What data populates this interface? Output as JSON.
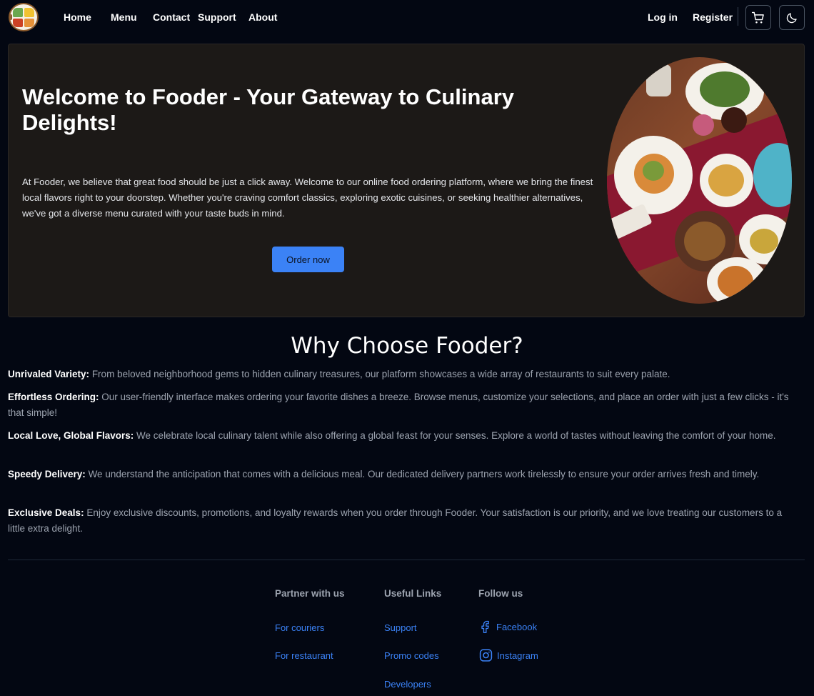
{
  "nav": {
    "links": [
      "Home",
      "Menu",
      "Contact",
      "Support",
      "About"
    ],
    "login": "Log in",
    "register": "Register"
  },
  "hero": {
    "title": "Welcome to Fooder - Your Gateway to Culinary Delights!",
    "text": "At Fooder, we believe that great food should be just a click away. Welcome to our online food ordering platform, where we bring the finest local flavors right to your doorstep. Whether you're craving comfort classics, exploring exotic cuisines, or seeking healthier alternatives, we've got a diverse menu curated with your taste buds in mind.",
    "button": "Order now"
  },
  "why": {
    "title": "Why Choose Fooder?",
    "items": [
      {
        "label": "Unrivaled Variety:",
        "text": " From beloved neighborhood gems to hidden culinary treasures, our platform showcases a wide array of restaurants to suit every palate."
      },
      {
        "label": "Effortless Ordering:",
        "text": " Our user-friendly interface makes ordering your favorite dishes a breeze. Browse menus, customize your selections, and place an order with just a few clicks - it's that simple!"
      },
      {
        "label": "Local Love, Global Flavors:",
        "text": " We celebrate local culinary talent while also offering a global feast for your senses. Explore a world of tastes without leaving the comfort of your home."
      },
      {
        "label": "Speedy Delivery:",
        "text": " We understand the anticipation that comes with a delicious meal. Our dedicated delivery partners work tirelessly to ensure your order arrives fresh and timely."
      },
      {
        "label": "Exclusive Deals:",
        "text": " Enjoy exclusive discounts, promotions, and loyalty rewards when you order through Fooder. Your satisfaction is our priority, and we love treating our customers to a little extra delight."
      }
    ]
  },
  "footer": {
    "partner": {
      "heading": "Partner with us",
      "links": [
        "For couriers",
        "For restaurant"
      ]
    },
    "useful": {
      "heading": "Useful Links",
      "links": [
        "Support",
        "Promo codes",
        "Developers"
      ]
    },
    "follow": {
      "heading": "Follow us",
      "links": [
        "Facebook",
        "Instagram"
      ]
    }
  },
  "colors": {
    "background": "#030712",
    "hero_bg": "#1c1917",
    "accent": "#3b82f6"
  },
  "icons": [
    "logo",
    "cart-icon",
    "moon-icon",
    "facebook-icon",
    "instagram-icon"
  ]
}
